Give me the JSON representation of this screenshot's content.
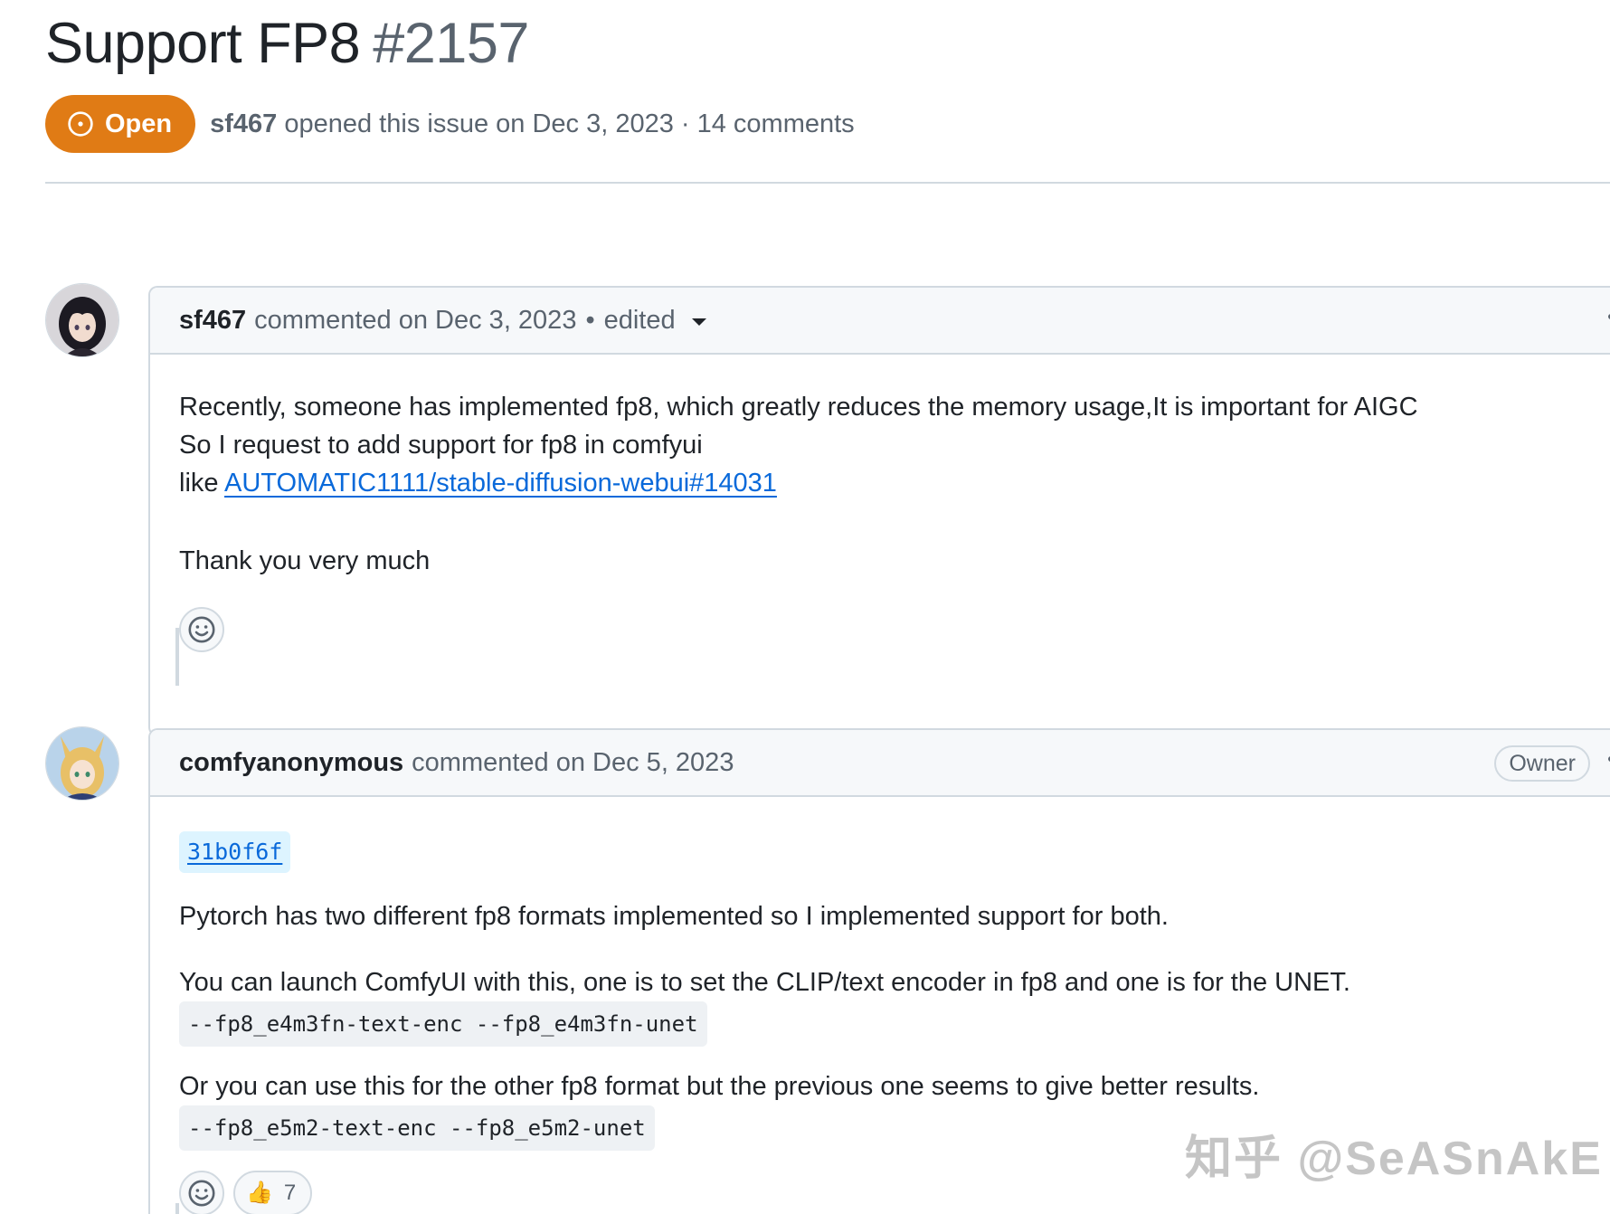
{
  "issue": {
    "title": "Support FP8",
    "number": "#2157",
    "state_label": "Open",
    "author": "sf467",
    "meta": "opened this issue on Dec 3, 2023 · 14 comments",
    "state_color": "#e07b15"
  },
  "comments": [
    {
      "author": "sf467",
      "when": "commented on Dec 3, 2023",
      "separator": "•",
      "edited_label": "edited",
      "body": {
        "line1": "Recently, someone has implemented fp8, which greatly reduces the memory usage,It is important for AIGC",
        "line2": "So I request to add support for fp8 in comfyui",
        "line3_prefix": "like ",
        "line3_link": "AUTOMATIC1111/stable-diffusion-webui#14031",
        "line4": "Thank you very much"
      },
      "avatar_icon": "anime-avatar-dark-hair",
      "reaction_icon": "smiley-icon"
    },
    {
      "author": "comfyanonymous",
      "when": "commented on Dec 5, 2023",
      "badge": "Owner",
      "body": {
        "commit_sha": "31b0f6f",
        "p1": "Pytorch has two different fp8 formats implemented so I implemented support for both.",
        "p2": "You can launch ComfyUI with this, one is to set the CLIP/text encoder in fp8 and one is for the UNET.",
        "code1": "--fp8_e4m3fn-text-enc --fp8_e4m3fn-unet",
        "p3": "Or you can use this for the other fp8 format but the previous one seems to give better results.",
        "code2": "--fp8_e5m2-text-enc --fp8_e5m2-unet"
      },
      "avatar_icon": "anime-avatar-fox-ears",
      "reactions": [
        {
          "emoji": "👍",
          "icon": "thumbs-up-icon",
          "count": "7"
        }
      ]
    }
  ],
  "watermark": "知乎 @SeASnAkE"
}
